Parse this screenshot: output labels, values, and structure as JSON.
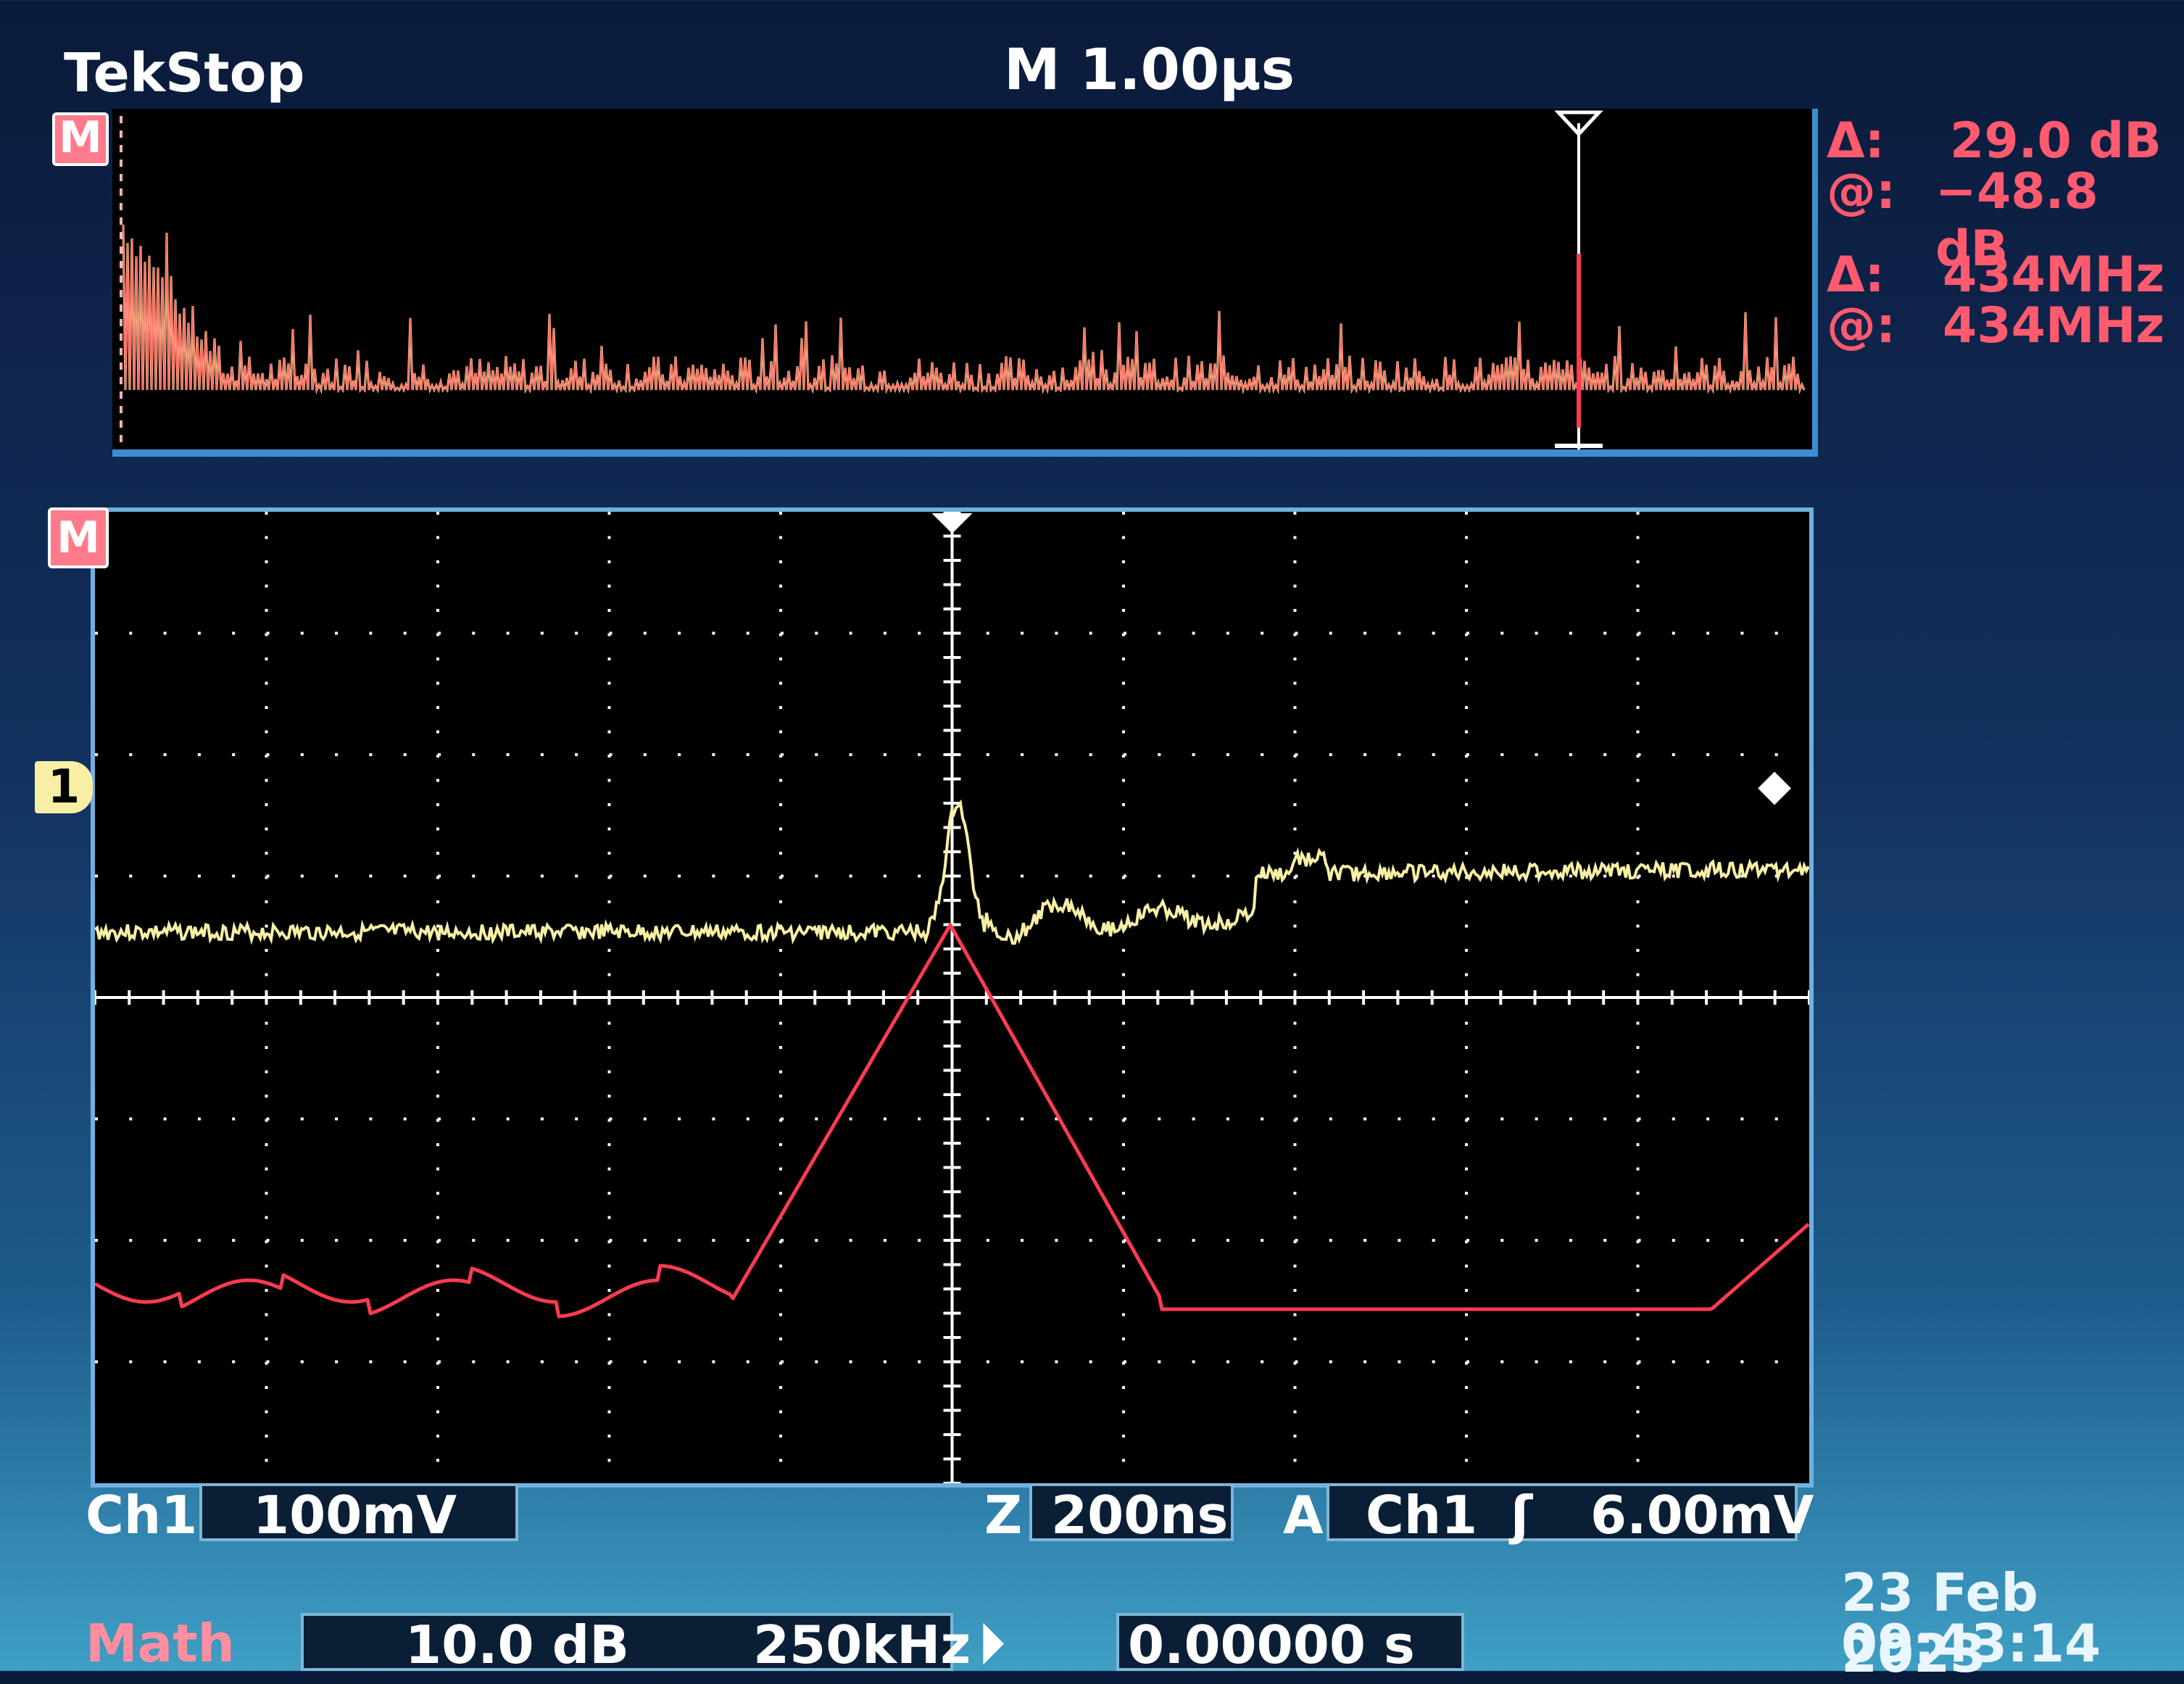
{
  "status": {
    "brand": "Tek",
    "run_state": "Stop",
    "horizontal_scale": "M 1.00µs"
  },
  "markers": {
    "math": "M",
    "channel1": "1"
  },
  "cursor_readouts": {
    "delta_amp_label": "Δ:",
    "delta_amp_value": "29.0 dB",
    "at_amp_label": "@:",
    "at_amp_value": "−48.8 dB",
    "delta_freq_label": "Δ:",
    "delta_freq_value": "434MHz",
    "at_freq_label": "@:",
    "at_freq_value": "434MHz"
  },
  "bottom_status": {
    "ch1_label": "Ch1",
    "ch1_scale": "100mV",
    "zoom_label": "Z",
    "zoom_scale": "200ns",
    "trigger_label": "A",
    "trigger_source": "Ch1",
    "trigger_slope": "ʃ",
    "trigger_level": "6.00mV",
    "math_label": "Math",
    "math_scale": "10.0 dB",
    "math_span": "250kHz",
    "delay_value": "0.00000 s"
  },
  "datetime": {
    "date": "23 Feb 2023",
    "time": "09:43:14"
  },
  "colors": {
    "fft_trace": "#ff3b4f",
    "ch1_trace": "#f7f0a4",
    "math_trace": "#ff3b4f",
    "graticule": "#ffffff",
    "screen_bg": "#000000"
  }
}
